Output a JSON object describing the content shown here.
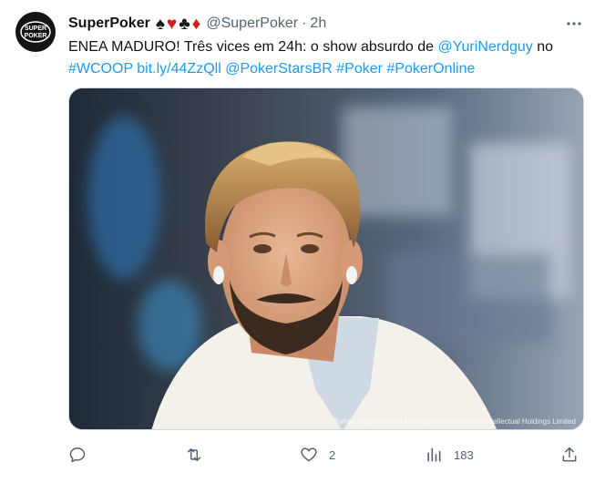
{
  "tweet": {
    "author_name": "SuperPoker",
    "author_handle": "@SuperPoker",
    "separator": "·",
    "time": "2h",
    "suits": [
      "♠",
      "♥",
      "♣",
      "♦"
    ],
    "avatar_text_1": "SUPER",
    "avatar_text_2": "POKER",
    "text": {
      "part1": "ENEA MADURO! Três vices em 24h: o show absurdo de ",
      "mention1": "@YuriNerdguy",
      "part2": " no ",
      "hashtag1": "#WCOOP",
      "link": "bit.ly/44ZzQll",
      "mention2": "@PokerStarsBR",
      "hashtag2": "#Poker",
      "hashtag3": "#PokerOnline"
    },
    "media": {
      "credit": "Tomas Stacha/Flutter Entertainment / National Intellectual Holdings Limited"
    },
    "actions": {
      "reply_count": "",
      "retweet_count": "",
      "like_count": "2",
      "views_count": "183"
    }
  },
  "icons": [
    "more-icon",
    "reply-icon",
    "retweet-icon",
    "like-icon",
    "views-icon",
    "share-icon"
  ],
  "colors": {
    "link": "#1d9bf0",
    "secondary_text": "#536471",
    "suit_red": "#d0201b"
  }
}
